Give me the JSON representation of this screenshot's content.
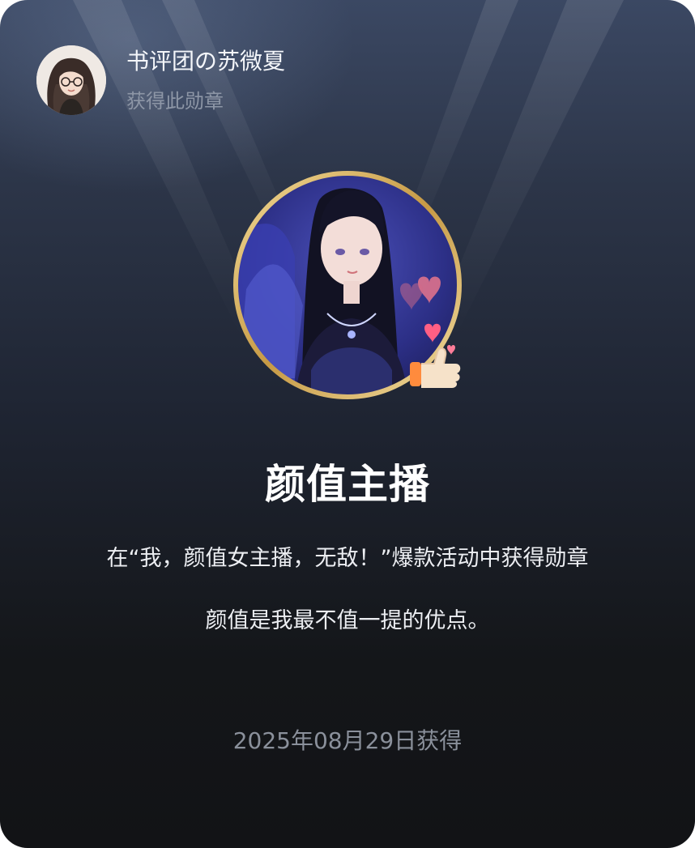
{
  "user": {
    "name": "书评团の苏微夏",
    "subtitle": "获得此勋章"
  },
  "badge": {
    "title": "颜值主播",
    "description": "在“我，颜值女主播，无敌！”爆款活动中获得勋章",
    "quote": "颜值是我最不值一提的优点。",
    "earned_text": "2025年08月29日获得",
    "ring_color": "#d8b66a"
  },
  "colors": {
    "card_top": "#3b4863",
    "card_bottom": "#121316",
    "subtitle": "#8d96a6",
    "date": "#8a909b"
  },
  "icons": {
    "avatar": "user-avatar-illustration",
    "badge": "badge-portrait-medal",
    "hearts": "heart-icon",
    "thumbs": "thumbs-up-icon"
  }
}
